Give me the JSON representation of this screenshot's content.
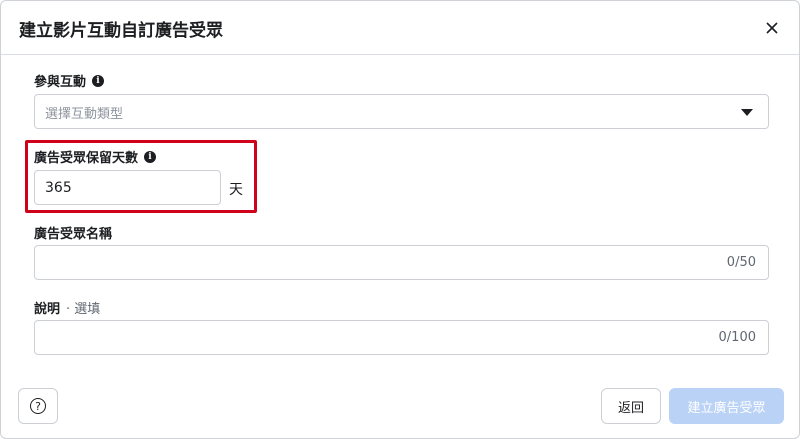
{
  "dialog": {
    "title": "建立影片互動自訂廣告受眾"
  },
  "engagement": {
    "label": "參與互動",
    "placeholder": "選擇互動類型"
  },
  "retention": {
    "label": "廣告受眾保留天數",
    "value": "365",
    "unit": "天"
  },
  "audience_name": {
    "label": "廣告受眾名稱",
    "counter": "0/50"
  },
  "description": {
    "label": "說明",
    "optional": "· 選填",
    "counter": "0/100"
  },
  "footer": {
    "help_glyph": "?",
    "back_label": "返回",
    "create_label": "建立廣告受眾"
  },
  "colors": {
    "highlight": "#d0021b",
    "primary_disabled": "#b9d2f5"
  },
  "icons": [
    "close-icon",
    "info-icon",
    "caret-down-icon",
    "help-icon"
  ]
}
